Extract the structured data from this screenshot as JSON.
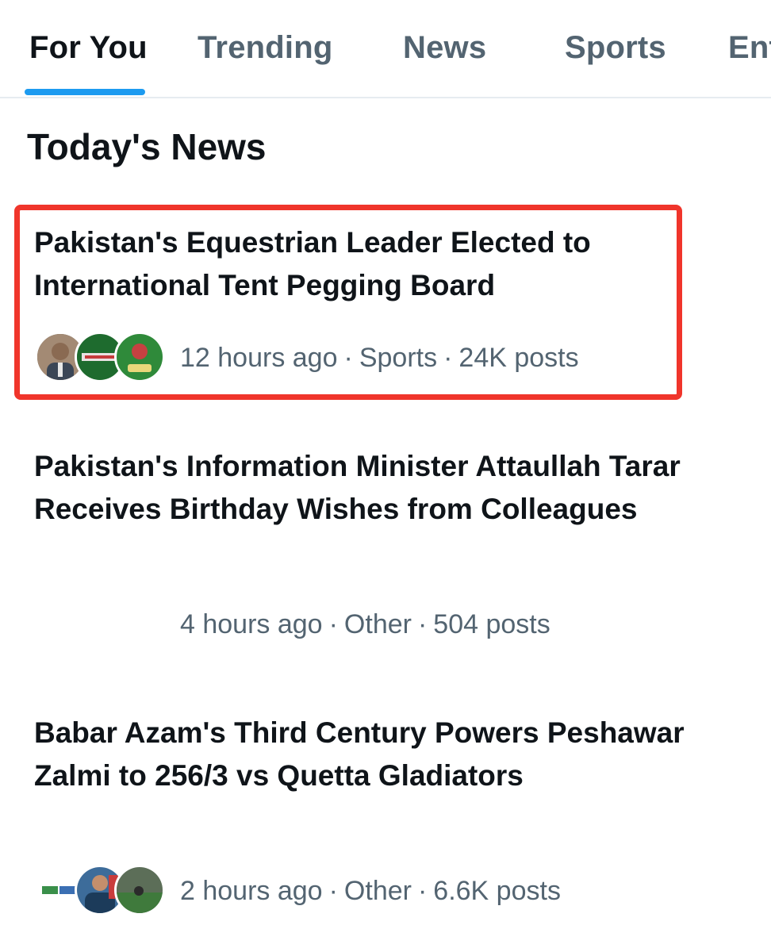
{
  "tabs": [
    {
      "label": "For You",
      "active": true
    },
    {
      "label": "Trending",
      "active": false
    },
    {
      "label": "News",
      "active": false
    },
    {
      "label": "Sports",
      "active": false
    },
    {
      "label": "Ent",
      "active": false
    }
  ],
  "section_title": "Today's News",
  "items": [
    {
      "headline": "Pakistan's Equestrian Leader Elected to International Tent Pegging Board",
      "time": "12 hours ago",
      "category": "Sports",
      "posts": "24K posts",
      "highlighted": true,
      "avatars": [
        "person-avatar",
        "green-logo-avatar",
        "sultan-logo-avatar"
      ]
    },
    {
      "headline": "Pakistan's Information Minister Attaullah Tarar Receives Birthday Wishes from Colleagues",
      "time": "4 hours ago",
      "category": "Other",
      "posts": "504 posts",
      "highlighted": false,
      "avatars": []
    },
    {
      "headline": "Babar Azam's Third Century Powers Peshawar Zalmi to 256/3 vs Quetta Gladiators",
      "time": "2 hours ago",
      "category": "Other",
      "posts": "6.6K posts",
      "highlighted": false,
      "avatars": [
        "psl-logo-avatar",
        "cricketer-avatar",
        "stadium-avatar"
      ]
    }
  ],
  "separator": "·",
  "colors": {
    "accent": "#1d9bf0",
    "highlight": "#f0352b",
    "text_primary": "#0f1419",
    "text_secondary": "#536471"
  }
}
